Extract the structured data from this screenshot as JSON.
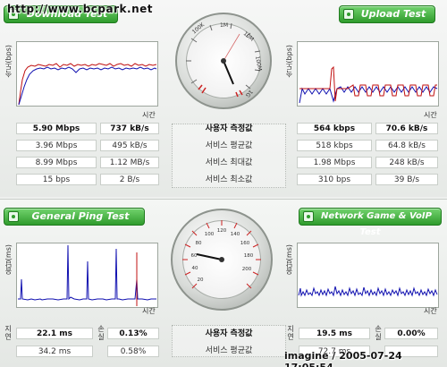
{
  "watermark_top": "http://www.bcpark.net",
  "watermark_bottom": "imagine / 2005-07-24 17:05:54",
  "download": {
    "tab_label": "Download Test",
    "y_axis": "속도(bps)",
    "x_axis": "시간"
  },
  "upload": {
    "tab_label": "Upload Test",
    "y_axis": "속도(bps)",
    "x_axis": "시간"
  },
  "ping": {
    "tab_label": "General Ping Test",
    "y_axis": "응답(ms)",
    "x_axis": "시간"
  },
  "game": {
    "tab_label": "Network Game & VoIP Test",
    "y_axis": "응답(ms)",
    "x_axis": "시간"
  },
  "speed_gauge": {
    "ticks": [
      "100K",
      "1M",
      "10M",
      "100M",
      "1G"
    ]
  },
  "ping_gauge": {
    "ticks": [
      "20",
      "40",
      "60",
      "80",
      "100",
      "120",
      "140",
      "160",
      "180",
      "200"
    ]
  },
  "speed_table": {
    "labels": [
      "사용자 측정값",
      "서비스 평균값",
      "서비스 최대값",
      "서비스 최소값"
    ],
    "download": [
      [
        "5.90 Mbps",
        "737 kB/s"
      ],
      [
        "3.96 Mbps",
        "495 kB/s"
      ],
      [
        "8.99 Mbps",
        "1.12 MB/s"
      ],
      [
        "15 bps",
        "2 B/s"
      ]
    ],
    "upload": [
      [
        "564 kbps",
        "70.6 kB/s"
      ],
      [
        "518 kbps",
        "64.8 kB/s"
      ],
      [
        "1.98 Mbps",
        "248 kB/s"
      ],
      [
        "310 bps",
        "39 B/s"
      ]
    ]
  },
  "ping_table": {
    "labels": [
      "사용자 측정값",
      "서비스 평균값"
    ],
    "latency_label": "지연",
    "loss_label": "손실",
    "ping": [
      [
        "22.1 ms",
        "0.13%"
      ],
      [
        "34.2 ms",
        "0.58%"
      ]
    ],
    "game": [
      [
        "19.5 ms",
        "0.00%"
      ],
      [
        "72.7 ms",
        ""
      ]
    ]
  },
  "colors": {
    "tab_green": "#2f9b2c",
    "download_red": "#c01010",
    "download_blue": "#1010b0",
    "needle": "#111111",
    "ticks_red": "#cc2222"
  }
}
